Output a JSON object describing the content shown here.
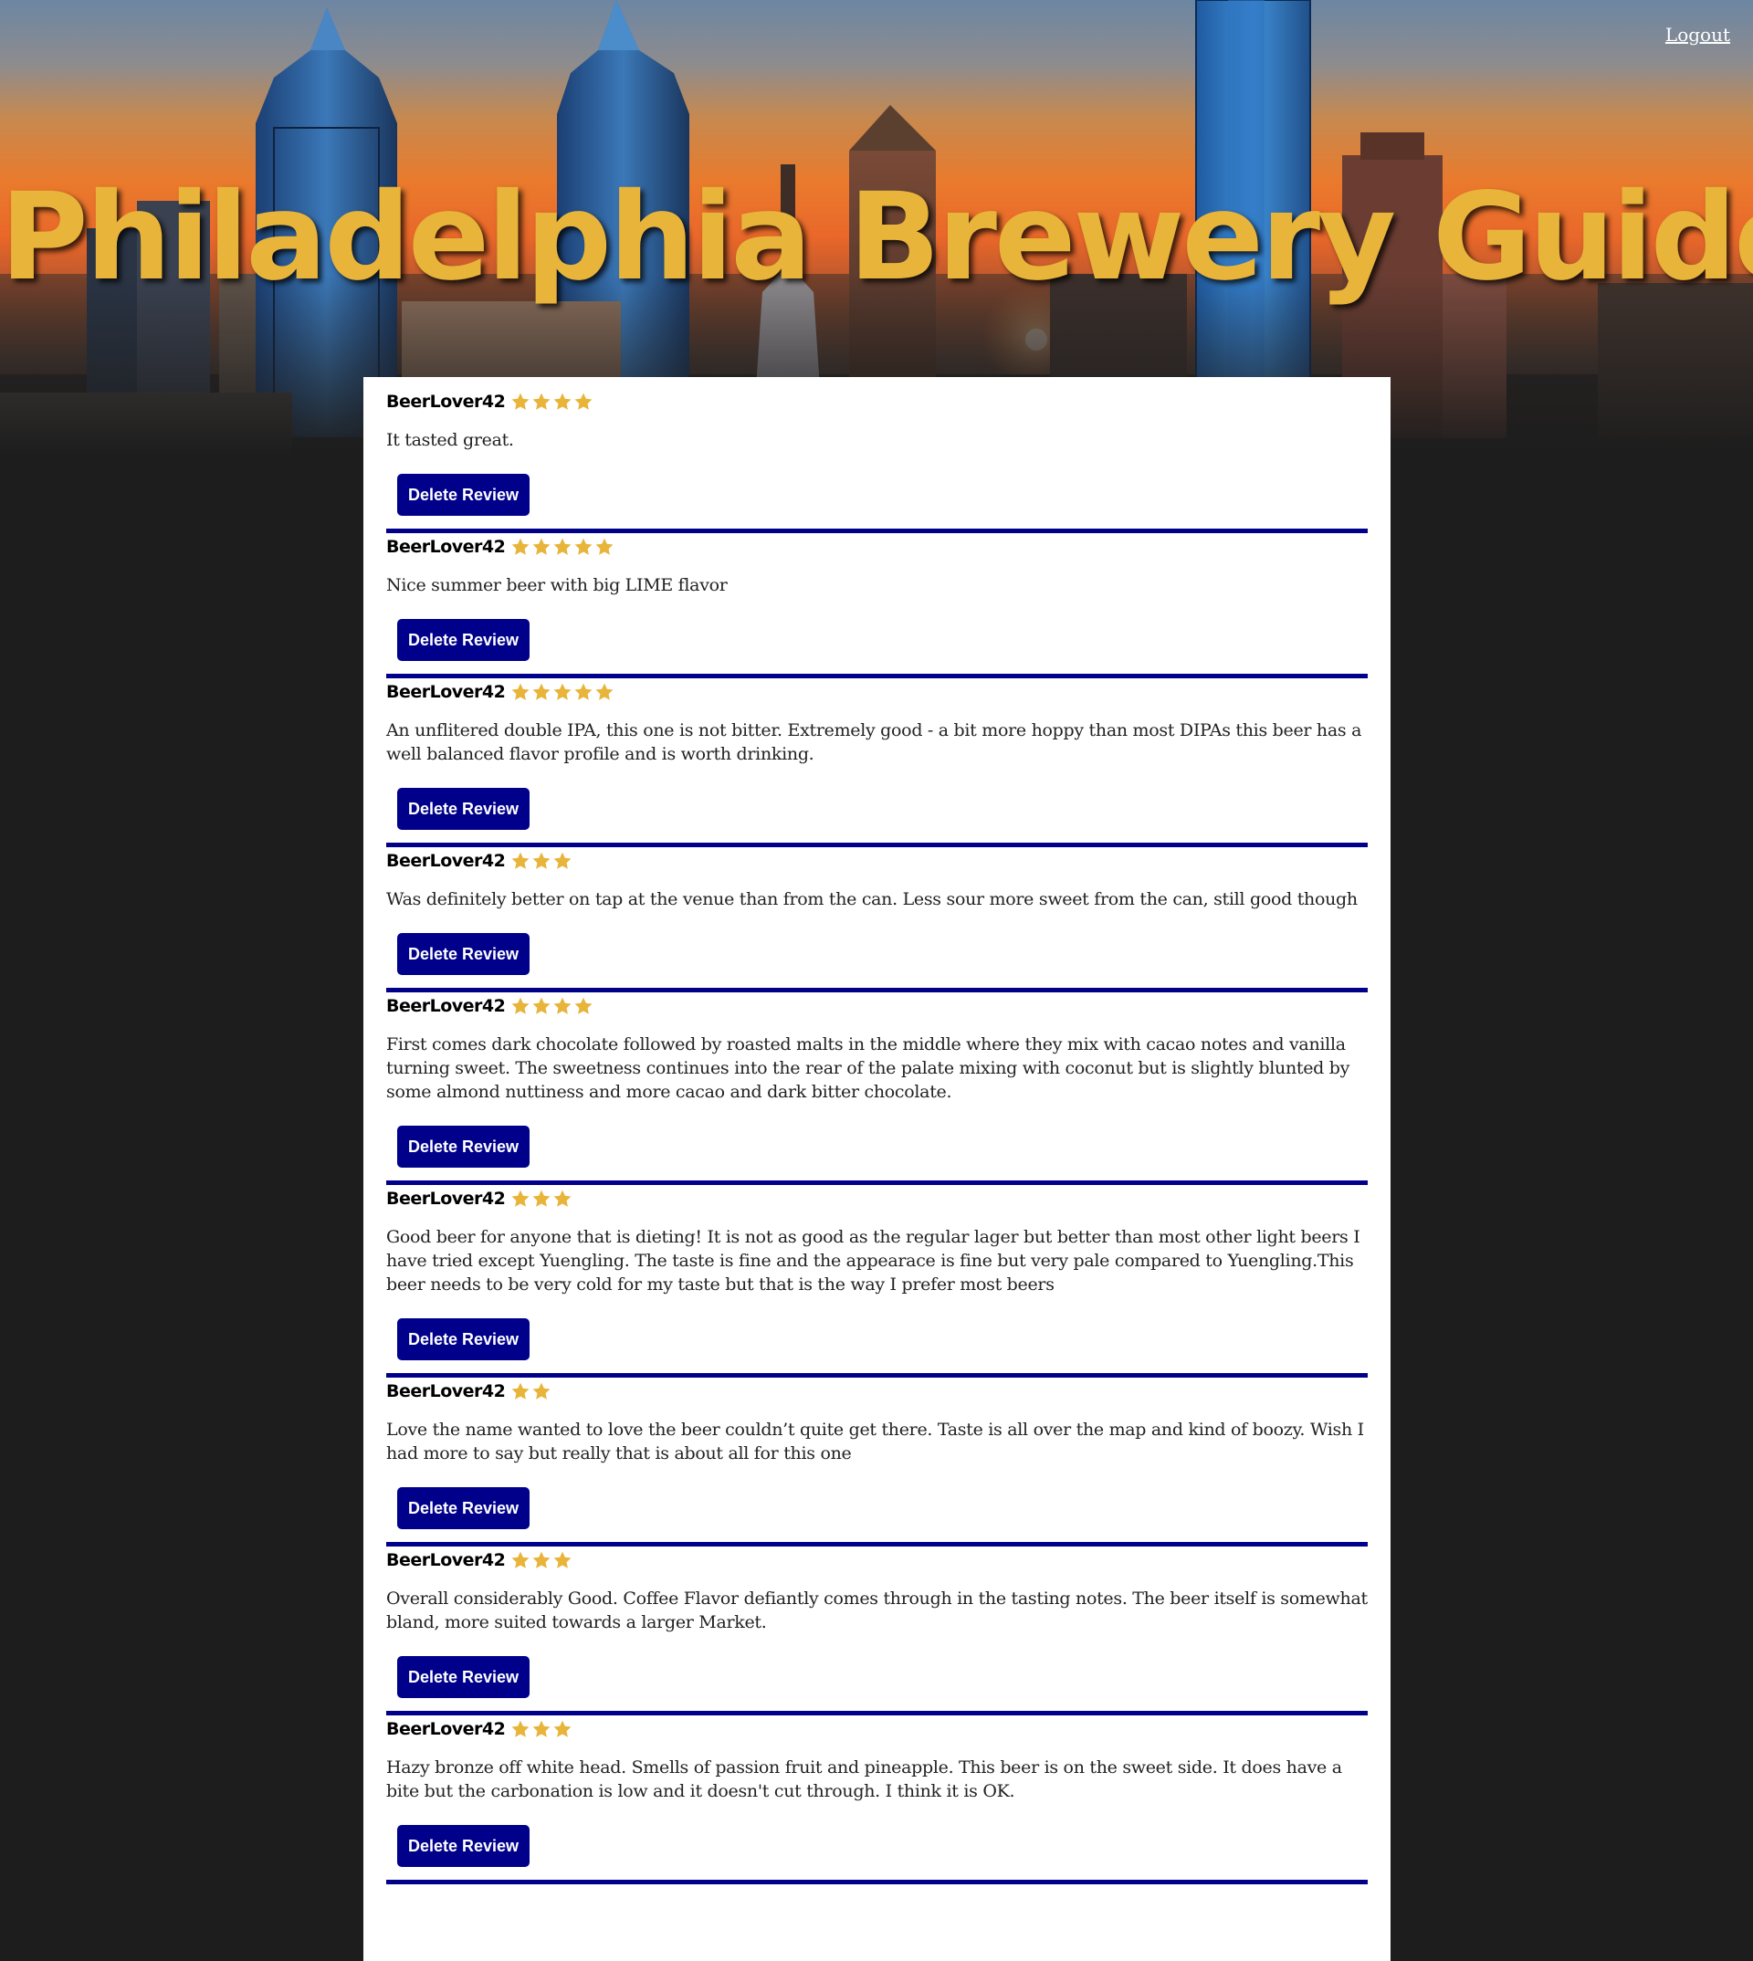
{
  "header": {
    "title": "Philadelphia Brewery Guide",
    "logout_label": "Logout"
  },
  "colors": {
    "accent": "#00008b",
    "title_gold": "#e8b43a",
    "star_gold": "#e8b43a",
    "page_background": "#1d1d1d"
  },
  "reviews": [
    {
      "user": "BeerLover42",
      "rating": 4,
      "text": "It tasted great.",
      "delete_label": "Delete Review"
    },
    {
      "user": "BeerLover42",
      "rating": 5,
      "text": "Nice summer beer with big LIME flavor",
      "delete_label": "Delete Review"
    },
    {
      "user": "BeerLover42",
      "rating": 5,
      "text": "An unflitered double IPA, this one is not bitter. Extremely good - a bit more hoppy than most DIPAs this beer has a well balanced flavor profile and is worth drinking.",
      "delete_label": "Delete Review"
    },
    {
      "user": "BeerLover42",
      "rating": 3,
      "text": "Was definitely better on tap at the venue than from the can. Less sour more sweet from the can, still good though",
      "delete_label": "Delete Review"
    },
    {
      "user": "BeerLover42",
      "rating": 4,
      "text": "First comes dark chocolate followed by roasted malts in the middle where they mix with cacao notes and vanilla turning sweet. The sweetness continues into the rear of the palate mixing with coconut but is slightly blunted by some almond nuttiness and more cacao and dark bitter chocolate.",
      "delete_label": "Delete Review"
    },
    {
      "user": "BeerLover42",
      "rating": 3,
      "text": "Good beer for anyone that is dieting! It is not as good as the regular lager but better than most other light beers I have tried except Yuengling. The taste is fine and the appearace is fine but very pale compared to Yuengling.This beer needs to be very cold for my taste but that is the way I prefer most beers",
      "delete_label": "Delete Review"
    },
    {
      "user": "BeerLover42",
      "rating": 2,
      "text": "Love the name wanted to love the beer couldn’t quite get there. Taste is all over the map and kind of boozy. Wish I had more to say but really that is about all for this one",
      "delete_label": "Delete Review"
    },
    {
      "user": "BeerLover42",
      "rating": 3,
      "text": "Overall considerably Good. Coffee Flavor defiantly comes through in the tasting notes. The beer itself is somewhat bland, more suited towards a larger Market.",
      "delete_label": "Delete Review"
    },
    {
      "user": "BeerLover42",
      "rating": 3,
      "text": "Hazy bronze off white head. Smells of passion fruit and pineapple. This beer is on the sweet side. It does have a bite but the carbonation is low and it doesn't cut through. I think it is OK.",
      "delete_label": "Delete Review"
    }
  ]
}
